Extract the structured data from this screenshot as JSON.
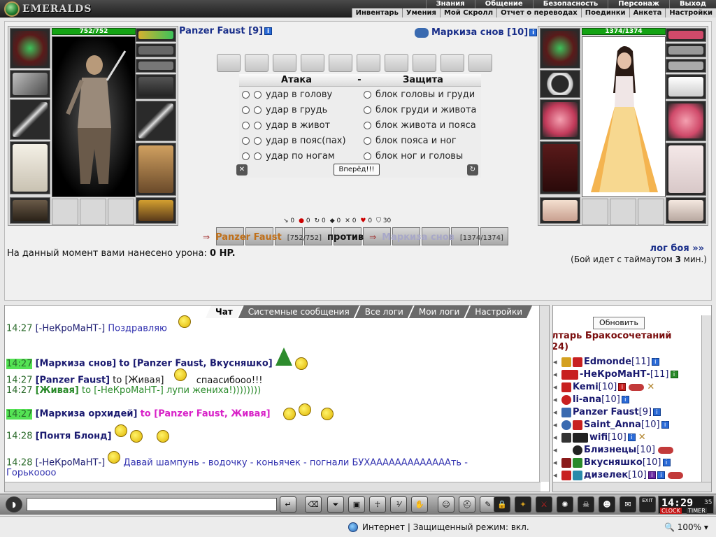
{
  "app": {
    "logo_text": "EMERALDS"
  },
  "menu_top": [
    "Знания",
    "Общение",
    "Безопасность",
    "Персонаж",
    "Выход"
  ],
  "menu_sub": [
    "Инвентарь",
    "Умения",
    "Мой Скролл",
    "Отчет о переводах",
    "Поединки",
    "Анкета",
    "Настройки"
  ],
  "player": {
    "name": "Panzer Faust [9]",
    "hp": "752/752",
    "hp_short": "[752/752]",
    "short_name": "Panzer Faust"
  },
  "opponent": {
    "name": "Маркиза снов [10]",
    "hp": "1374/1374",
    "hp_short": "[1374/1374]",
    "short_name": "Маркиза снов"
  },
  "combat": {
    "attack_header": "Атака",
    "defense_header": "Защита",
    "separator": "-",
    "attacks": [
      "удар в голову",
      "удар в грудь",
      "удар в живот",
      "удар в пояс(пах)",
      "удар по ногам"
    ],
    "defenses": [
      "блок головы и груди",
      "блок груди и живота",
      "блок живота и пояса",
      "блок пояса и ног",
      "блок ног и головы"
    ],
    "forward_button": "Вперёд!!!",
    "stats": [
      "0",
      "0",
      "0",
      "0",
      "0",
      "0",
      "30"
    ],
    "vs_word": "против",
    "damage_prefix": "На данный момент вами нанесено урона:",
    "damage_value": "0 HP.",
    "log_link": "лог боя »»",
    "timeout_prefix": "(Бой идет с таймаутом",
    "timeout_value": "3",
    "timeout_suffix": "мин.)"
  },
  "chat_tabs": [
    "Чат",
    "Системные сообщения",
    "Все логи",
    "Мои логи",
    "Настройки"
  ],
  "chat": [
    {
      "time": "14:27",
      "nick": "[-НеКроМаНТ-]",
      "text": "Поздравляю"
    },
    {
      "time": "14:27",
      "nick": "[Маркиза снов]",
      "to": "to [Panzer Faust, Вкусняшко]"
    },
    {
      "time": "14:27",
      "nick": "[Panzer Faust]",
      "to": "to [Живая]",
      "text": "спаасибооо!!!"
    },
    {
      "time": "14:27",
      "nick": "[Живая]",
      "to": "to [-НеКроМаНТ-]",
      "text": "лупи жениха!))))))))"
    },
    {
      "time": "14:27",
      "nick": "[Маркиза орхидей]",
      "to": "to [Panzer Faust, Живая]"
    },
    {
      "time": "14:28",
      "nick": "[Понтя Блонд]"
    },
    {
      "time": "14:28",
      "nick": "[-НеКроМаНТ-]",
      "text": "Давай шампунь - водочку - коньячек - погнали БУХАААААААААААААть -",
      "text2": "Горькоооо"
    }
  ],
  "right_pane": {
    "refresh_button": "Обновить",
    "room_title": "лтарь Бракосочетаний",
    "room_count": "24)",
    "players": [
      {
        "name": "Edmonde",
        "level": "[11]"
      },
      {
        "name": "-НеКроМаНТ-",
        "level": "[11]"
      },
      {
        "name": "Kemi",
        "level": "[10]"
      },
      {
        "name": "li-ana",
        "level": "[10]"
      },
      {
        "name": "Panzer Faust",
        "level": "[9]"
      },
      {
        "name": "Saint_Anna",
        "level": "[10]"
      },
      {
        "name": "wifi",
        "level": "[10]"
      },
      {
        "name": "Близнецы",
        "level": "[10]"
      },
      {
        "name": "Вкусняшко",
        "level": "[10]"
      },
      {
        "name": "дизелек",
        "level": "[10]"
      }
    ]
  },
  "bottom": {
    "clock_time": "14:29",
    "clock_seconds": "35",
    "clock_label": "CLOCK",
    "timer_label": "TIMER",
    "exit_label": "EXIT"
  },
  "statusbar": {
    "text": "Интернет | Защищенный режим: вкл.",
    "zoom": "100%"
  }
}
